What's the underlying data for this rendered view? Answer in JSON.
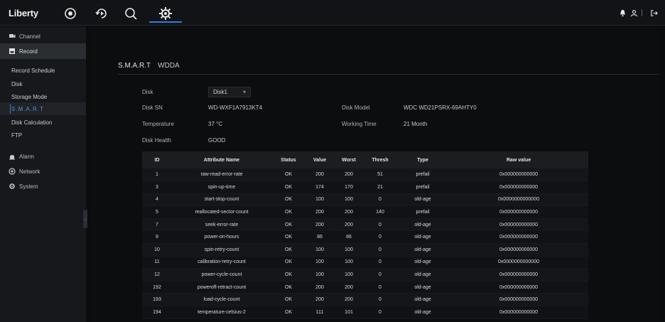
{
  "app": {
    "brand": "Liberty"
  },
  "nav": {
    "icons": [
      "live-view-icon",
      "playback-icon",
      "search-icon",
      "settings-icon"
    ]
  },
  "sidebar": {
    "groups": [
      {
        "label": "Channel",
        "icon": "camera-icon"
      },
      {
        "label": "Record",
        "icon": "record-icon"
      }
    ],
    "record_items": [
      "Record Schedule",
      "Disk",
      "Storage Mode",
      "S.M.A.R.T",
      "Disk Calculation",
      "FTP"
    ],
    "bottom_groups": [
      {
        "label": "Alarm",
        "icon": "alarm-icon"
      },
      {
        "label": "Network",
        "icon": "network-icon"
      },
      {
        "label": "System",
        "icon": "system-icon"
      }
    ]
  },
  "tabs": [
    "S.M.A.R.T",
    "WDDA"
  ],
  "info": {
    "disk_label": "Disk",
    "disk_value": "Disk1",
    "disk_sn_label": "Disk SN",
    "disk_sn_value": "WD-WXF1A7913KT4",
    "disk_model_label": "Disk Model",
    "disk_model_value": "WDC WD21PSRX-69AHTY0",
    "temperature_label": "Temperature",
    "temperature_value": "37 °C",
    "working_time_label": "Working Time",
    "working_time_value": "21 Month",
    "disk_health_label": "Disk Health",
    "disk_health_value": "GOOD"
  },
  "table": {
    "headers": [
      "ID",
      "Attribute Name",
      "Status",
      "Value",
      "Worst",
      "Thresh",
      "Type",
      "Raw value"
    ],
    "rows": [
      [
        "1",
        "raw-read-error-rate",
        "OK",
        "200",
        "200",
        "51",
        "prefail",
        "0x000000000000"
      ],
      [
        "3",
        "spin-up-time",
        "OK",
        "174",
        "170",
        "21",
        "prefail",
        "0x000000000000"
      ],
      [
        "4",
        "start-stop-count",
        "OK",
        "100",
        "100",
        "0",
        "old-age",
        "0x0000000000000"
      ],
      [
        "5",
        "reallocated-sector-count",
        "OK",
        "200",
        "200",
        "140",
        "prefail",
        "0x000000000000"
      ],
      [
        "7",
        "seek-error-rate",
        "OK",
        "200",
        "200",
        "0",
        "old-age",
        "0x000000000000"
      ],
      [
        "9",
        "power-on-hours",
        "OK",
        "86",
        "86",
        "0",
        "old-age",
        "0x000000000000"
      ],
      [
        "10",
        "spin-retry-count",
        "OK",
        "100",
        "100",
        "0",
        "old-age",
        "0x000000000000"
      ],
      [
        "11",
        "calibration-retry-count",
        "OK",
        "100",
        "100",
        "0",
        "old-age",
        "0x0000000000000"
      ],
      [
        "12",
        "power-cycle-count",
        "OK",
        "100",
        "100",
        "0",
        "old-age",
        "0x000000000000"
      ],
      [
        "192",
        "poweroff-retract-count",
        "OK",
        "200",
        "200",
        "0",
        "old-age",
        "0x000000000000"
      ],
      [
        "193",
        "load-cycle-count",
        "OK",
        "200",
        "200",
        "0",
        "old-age",
        "0x000000000000"
      ],
      [
        "194",
        "temperature-celsius-2",
        "OK",
        "111",
        "101",
        "0",
        "old-age",
        "0x000000000000"
      ]
    ]
  },
  "colors": {
    "accent": "#2f7de1",
    "background": "#0b0c0e",
    "sidebar": "#16181b"
  }
}
